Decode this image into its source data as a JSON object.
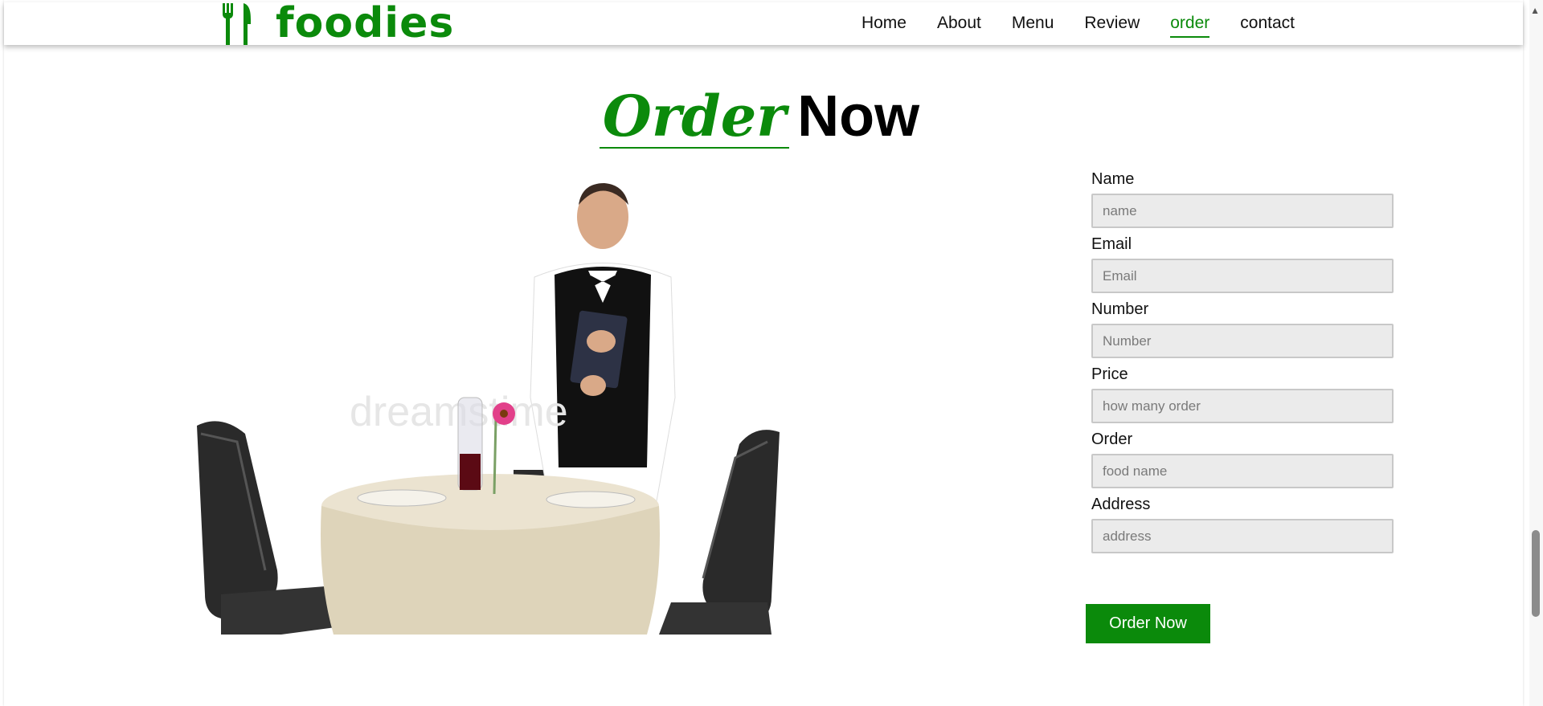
{
  "brand": {
    "name": "foodies",
    "icon": "fork-knife-icon",
    "color": "#0b8a0b"
  },
  "nav": {
    "items": [
      {
        "label": "Home"
      },
      {
        "label": "About"
      },
      {
        "label": "Menu"
      },
      {
        "label": "Review"
      },
      {
        "label": "order",
        "active": true
      },
      {
        "label": "contact"
      }
    ]
  },
  "section": {
    "title_accent": "Order",
    "title_main": "Now"
  },
  "scene": {
    "image": "waiter-with-table-and-chairs",
    "watermark": "dreamstime"
  },
  "form": {
    "fields": [
      {
        "label": "Name",
        "placeholder": "name"
      },
      {
        "label": "Email",
        "placeholder": "Email"
      },
      {
        "label": "Number",
        "placeholder": "Number"
      },
      {
        "label": "Price",
        "placeholder": "how many order"
      },
      {
        "label": "Order",
        "placeholder": "food name"
      },
      {
        "label": "Address",
        "placeholder": "address"
      }
    ],
    "submit_label": "Order Now"
  },
  "colors": {
    "accent": "#0b8a0b",
    "input_bg": "#ebebeb",
    "input_border": "#c8c8c8"
  },
  "scroll": {
    "position": 0.82
  }
}
